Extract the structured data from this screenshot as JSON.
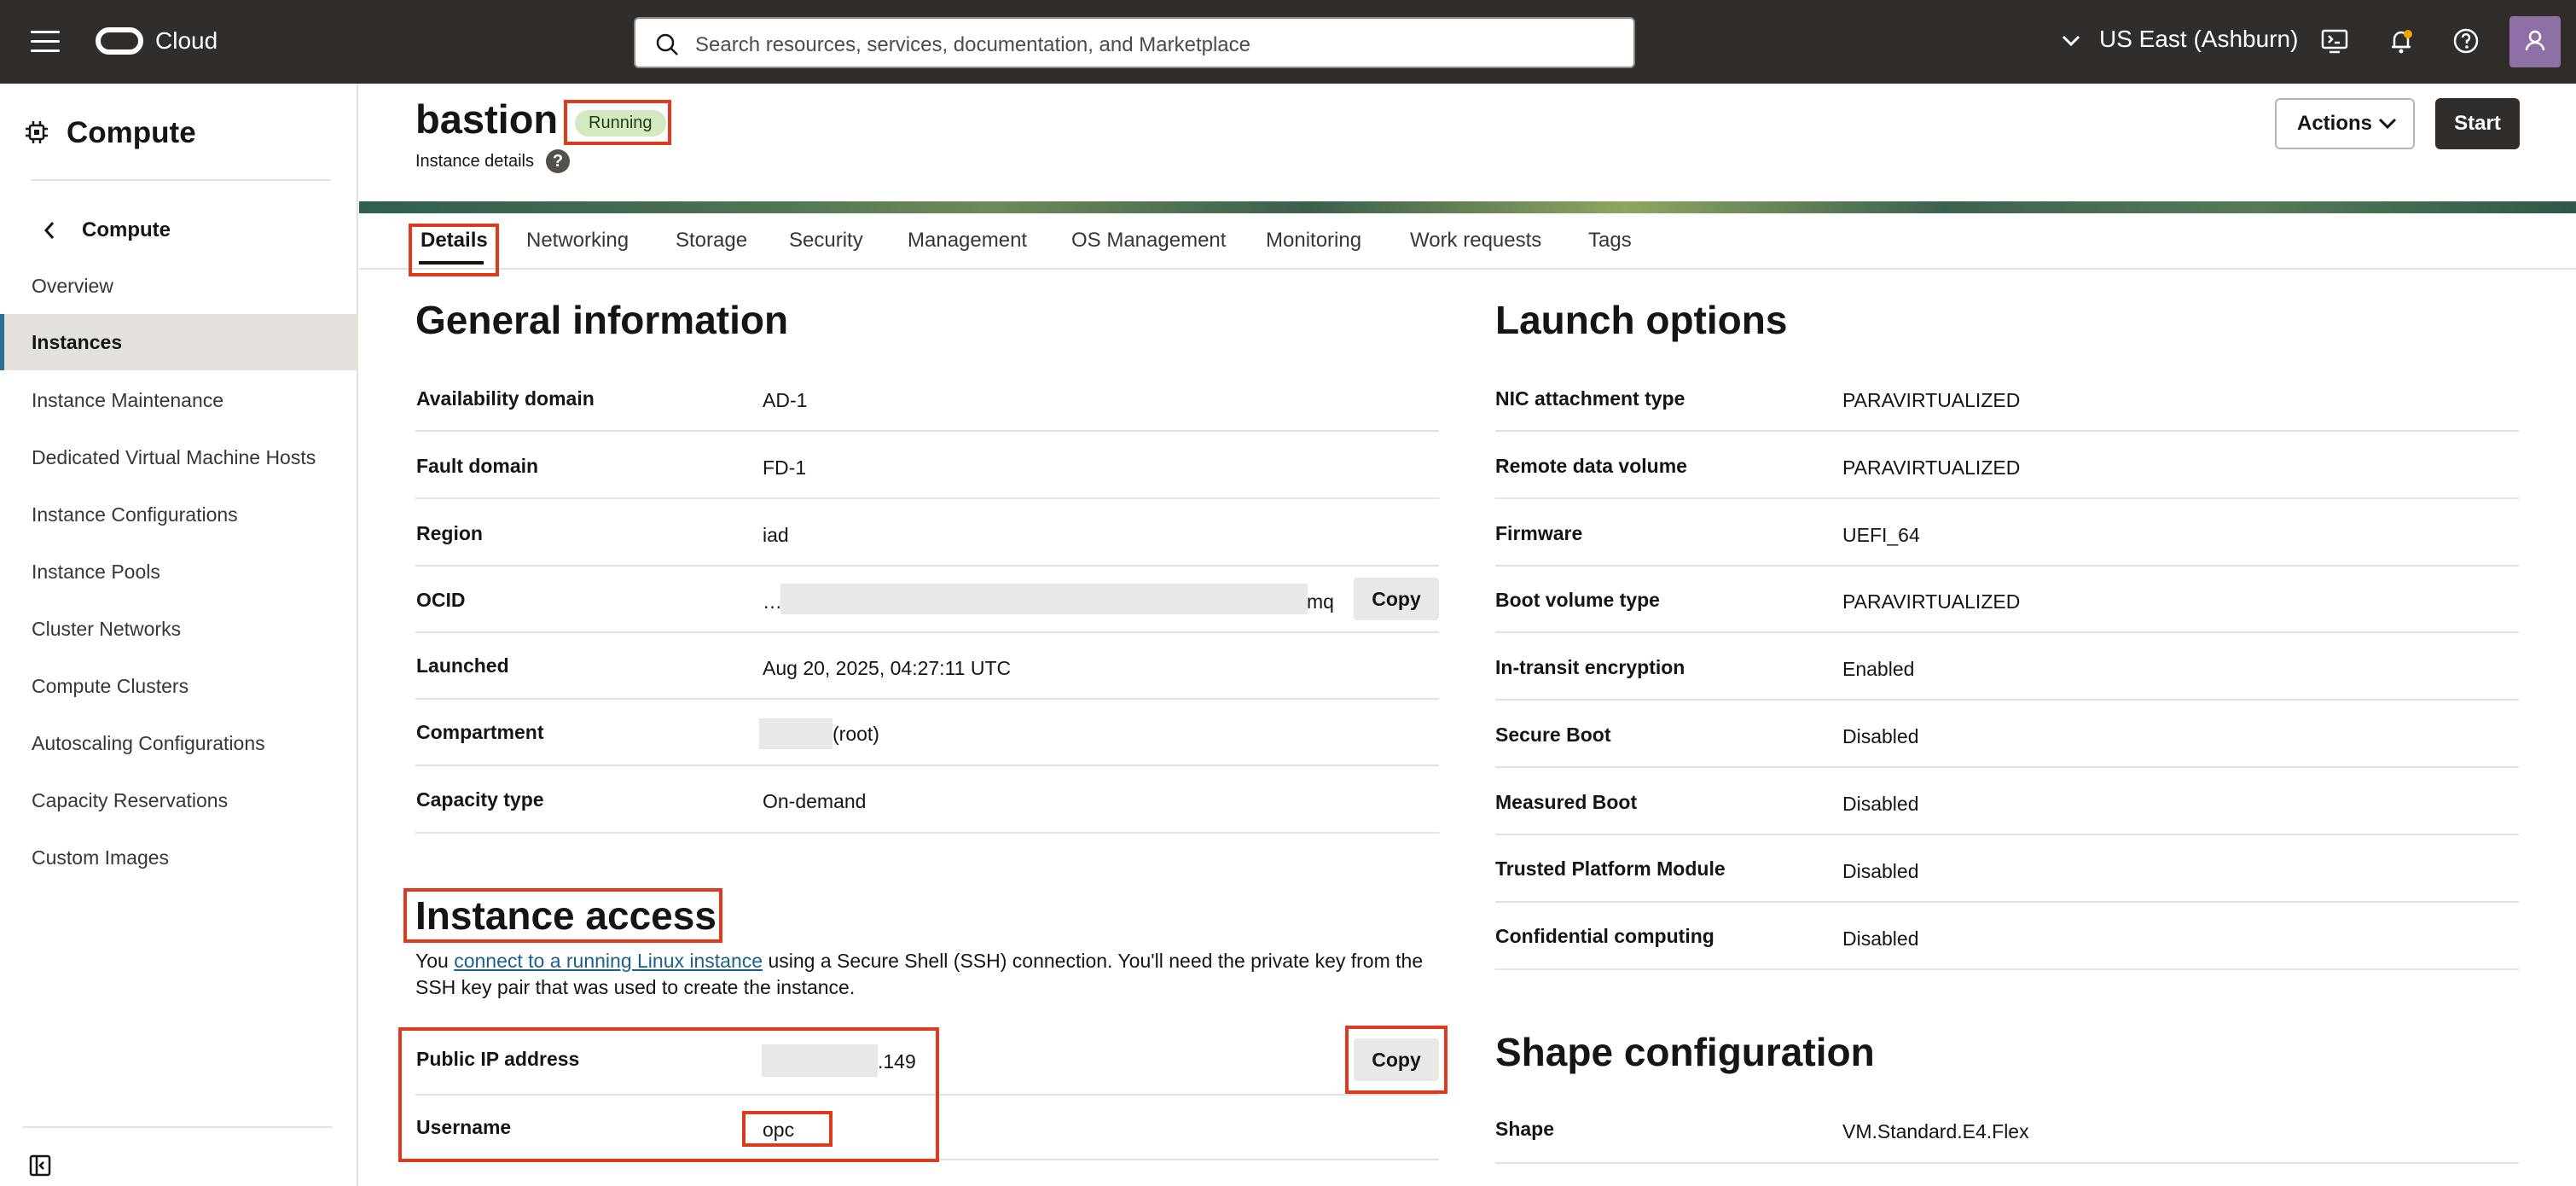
{
  "topbar": {
    "brand": "Cloud",
    "search_placeholder": "Search resources, services, documentation, and Marketplace",
    "region": "US East (Ashburn)"
  },
  "sidebar": {
    "title": "Compute",
    "back_label": "Compute",
    "items": [
      {
        "label": "Overview"
      },
      {
        "label": "Instances"
      },
      {
        "label": "Instance Maintenance"
      },
      {
        "label": "Dedicated Virtual Machine Hosts"
      },
      {
        "label": "Instance Configurations"
      },
      {
        "label": "Instance Pools"
      },
      {
        "label": "Cluster Networks"
      },
      {
        "label": "Compute Clusters"
      },
      {
        "label": "Autoscaling Configurations"
      },
      {
        "label": "Capacity Reservations"
      },
      {
        "label": "Custom Images"
      }
    ]
  },
  "header": {
    "title": "bastion",
    "status": "Running",
    "subtitle": "Instance details",
    "help": "?",
    "actions_label": "Actions",
    "start_label": "Start"
  },
  "tabs": [
    "Details",
    "Networking",
    "Storage",
    "Security",
    "Management",
    "OS Management",
    "Monitoring",
    "Work requests",
    "Tags"
  ],
  "general": {
    "title": "General information",
    "rows": [
      {
        "label": "Availability domain",
        "value": "AD-1"
      },
      {
        "label": "Fault domain",
        "value": "FD-1"
      },
      {
        "label": "Region",
        "value": "iad"
      },
      {
        "label": "OCID",
        "value_prefix": "…",
        "value_suffix": "mq",
        "copy": "Copy"
      },
      {
        "label": "Launched",
        "value": "Aug 20, 2025, 04:27:11 UTC"
      },
      {
        "label": "Compartment",
        "value": "(root)"
      },
      {
        "label": "Capacity type",
        "value": "On-demand"
      }
    ]
  },
  "access": {
    "title": "Instance access",
    "para_before": "You ",
    "link": "connect to a running Linux instance",
    "para_after": " using a Secure Shell (SSH) connection. You'll need the private key from the SSH key pair that was used to create the instance.",
    "rows": [
      {
        "label": "Public IP address",
        "value_suffix": ".149",
        "copy": "Copy"
      },
      {
        "label": "Username",
        "value": "opc"
      }
    ]
  },
  "launch": {
    "title": "Launch options",
    "rows": [
      {
        "label": "NIC attachment type",
        "value": "PARAVIRTUALIZED"
      },
      {
        "label": "Remote data volume",
        "value": "PARAVIRTUALIZED"
      },
      {
        "label": "Firmware",
        "value": "UEFI_64"
      },
      {
        "label": "Boot volume type",
        "value": "PARAVIRTUALIZED"
      },
      {
        "label": "In-transit encryption",
        "value": "Enabled"
      },
      {
        "label": "Secure Boot",
        "value": "Disabled"
      },
      {
        "label": "Measured Boot",
        "value": "Disabled"
      },
      {
        "label": "Trusted Platform Module",
        "value": "Disabled"
      },
      {
        "label": "Confidential computing",
        "value": "Disabled"
      }
    ]
  },
  "shape": {
    "title": "Shape configuration",
    "rows": [
      {
        "label": "Shape",
        "value": "VM.Standard.E4.Flex"
      }
    ]
  }
}
